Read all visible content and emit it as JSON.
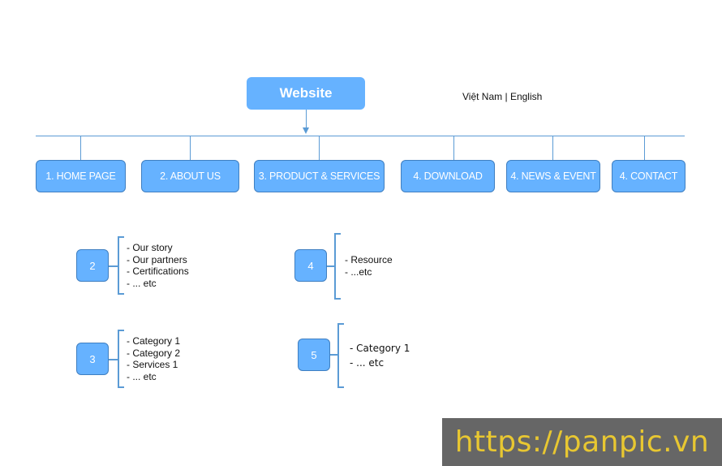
{
  "root": {
    "label": "Website"
  },
  "language_switch": {
    "vietnamese": "Việt Nam",
    "separator": " | ",
    "english": "English"
  },
  "nav": [
    {
      "label": "1. HOME PAGE"
    },
    {
      "label": "2. ABOUT US"
    },
    {
      "label": "3. PRODUCT & SERVICES"
    },
    {
      "label": "4. DOWNLOAD"
    },
    {
      "label": "4. NEWS & EVENT"
    },
    {
      "label": "4. CONTACT"
    }
  ],
  "details": [
    {
      "number": "2",
      "items": [
        "- Our story",
        "- Our partners",
        "- Certifications",
        "- ... etc"
      ]
    },
    {
      "number": "3",
      "items": [
        "- Category 1",
        "- Category 2",
        "- Services 1",
        "- ... etc"
      ]
    },
    {
      "number": "4",
      "items": [
        "- Resource",
        "- ...etc"
      ]
    },
    {
      "number": "5",
      "items": [
        "- Category 1",
        "- ... etc"
      ]
    }
  ],
  "watermark": {
    "text": "https://panpic.vn"
  },
  "colors": {
    "box_fill": "#66b2ff",
    "box_border": "#3f7fc1",
    "line": "#5b9bd5",
    "watermark_bg": "#666666",
    "watermark_text": "#e8c731"
  }
}
